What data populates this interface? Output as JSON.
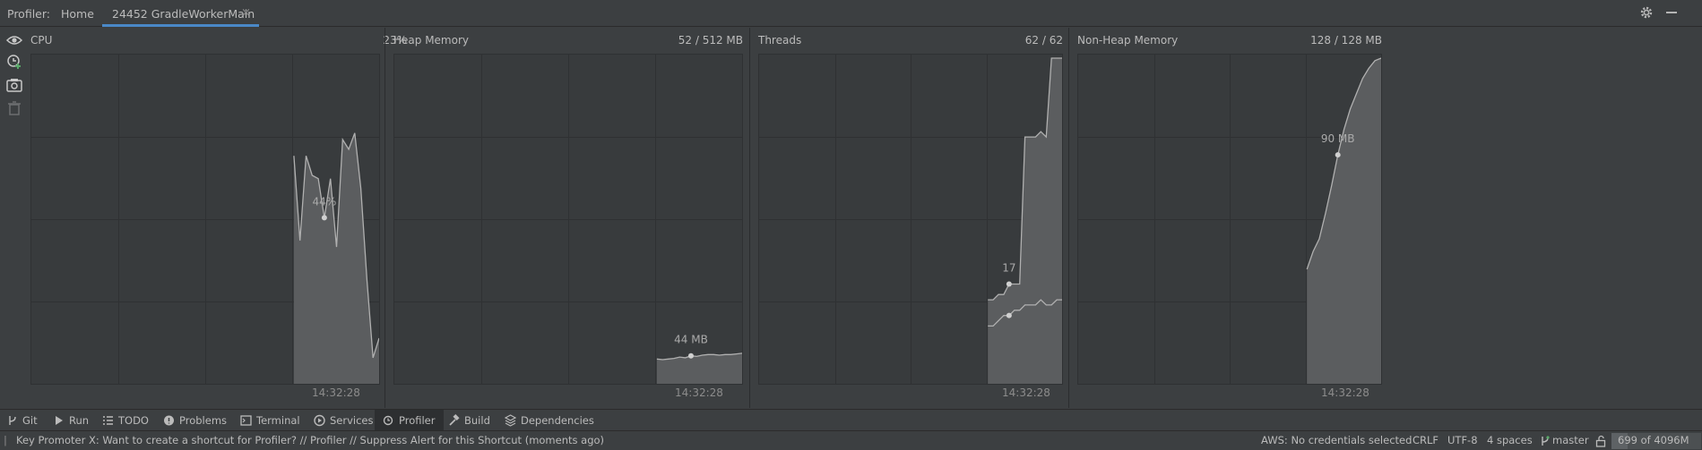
{
  "titlebar": {
    "profiler_label": "Profiler:",
    "home_tab": "Home",
    "session_tab": "24452 GradleWorkerMain",
    "close_glyph": "×",
    "settings_icon": "gear-icon",
    "minimize_icon": "minimize-icon"
  },
  "sidebar": {
    "icons": [
      "eye-icon",
      "add-session-icon",
      "capture-icon",
      "trash-icon"
    ]
  },
  "panels": [
    {
      "title": "CPU",
      "value": "23%",
      "time": "14:32:28",
      "tooltip": "44%",
      "chart_data": {
        "type": "area",
        "unit": "%",
        "series": [
          {
            "values": [
              70,
              44,
              70,
              64,
              63,
              51,
              63,
              42,
              75,
              72,
              77,
              60,
              32,
              8,
              14
            ]
          }
        ],
        "hover_value": 44,
        "ylim": [
          0,
          100
        ]
      }
    },
    {
      "title": "Heap Memory",
      "value": "52 / 512 MB",
      "time": "14:32:28",
      "tooltip": "44 MB",
      "chart_data": {
        "type": "area",
        "unit": "MB",
        "series": [
          {
            "values": [
              39,
              38,
              39,
              40,
              42,
              41,
              44,
              43,
              45,
              46,
              46,
              45,
              46,
              46,
              47,
              48
            ]
          }
        ],
        "hover_value": 44,
        "ylim": [
          0,
          512
        ]
      }
    },
    {
      "title": "Threads",
      "value": "62 / 62",
      "time": "14:32:28",
      "tooltip": "17",
      "chart_data": {
        "type": "area",
        "unit": "threads",
        "series": [
          {
            "values": [
              16,
              16,
              17,
              17,
              19,
              19,
              19,
              47,
              47,
              47,
              48,
              47,
              62,
              62,
              62
            ]
          },
          {
            "values": [
              11,
              11,
              12,
              13,
              13,
              14,
              14,
              15,
              15,
              15,
              16,
              15,
              15,
              16,
              16
            ]
          }
        ],
        "hover_value": 17,
        "ylim": [
          0,
          62
        ]
      }
    },
    {
      "title": "Non-Heap Memory",
      "value": "128 / 128 MB",
      "time": "14:32:28",
      "tooltip": "90 MB",
      "chart_data": {
        "type": "area",
        "unit": "MB",
        "series": [
          {
            "values": [
              45,
              52,
              57,
              67,
              78,
              90,
              100,
              108,
              114,
              120,
              124,
              127,
              128
            ]
          }
        ],
        "hover_value": 90,
        "ylim": [
          0,
          128
        ]
      }
    }
  ],
  "toolwindows": [
    {
      "label": "Git",
      "icon": "git-branch-icon"
    },
    {
      "label": "Run",
      "icon": "run-icon"
    },
    {
      "label": "TODO",
      "icon": "todo-list-icon"
    },
    {
      "label": "Problems",
      "icon": "problems-icon"
    },
    {
      "label": "Terminal",
      "icon": "terminal-icon"
    },
    {
      "label": "Services",
      "icon": "services-icon"
    },
    {
      "label": "Profiler",
      "icon": "profiler-icon",
      "active": true
    },
    {
      "label": "Build",
      "icon": "build-hammer-icon"
    },
    {
      "label": "Dependencies",
      "icon": "dependencies-icon"
    }
  ],
  "statusbar": {
    "message": "Key Promoter X: Want to create a shortcut for Profiler? // Profiler // Suppress Alert for this Shortcut (moments ago)",
    "aws": "AWS: No credentials selected",
    "line_sep": "CRLF",
    "encoding": "UTF-8",
    "indent": "4 spaces",
    "branch": "master",
    "memory": "699 of 4096M"
  },
  "colors": {
    "background": "#3c3f41",
    "chart_bg": "#383b3d",
    "area_fill": "#5b5d5f",
    "line": "#b0b0b0",
    "accent": "#4a88c7"
  }
}
